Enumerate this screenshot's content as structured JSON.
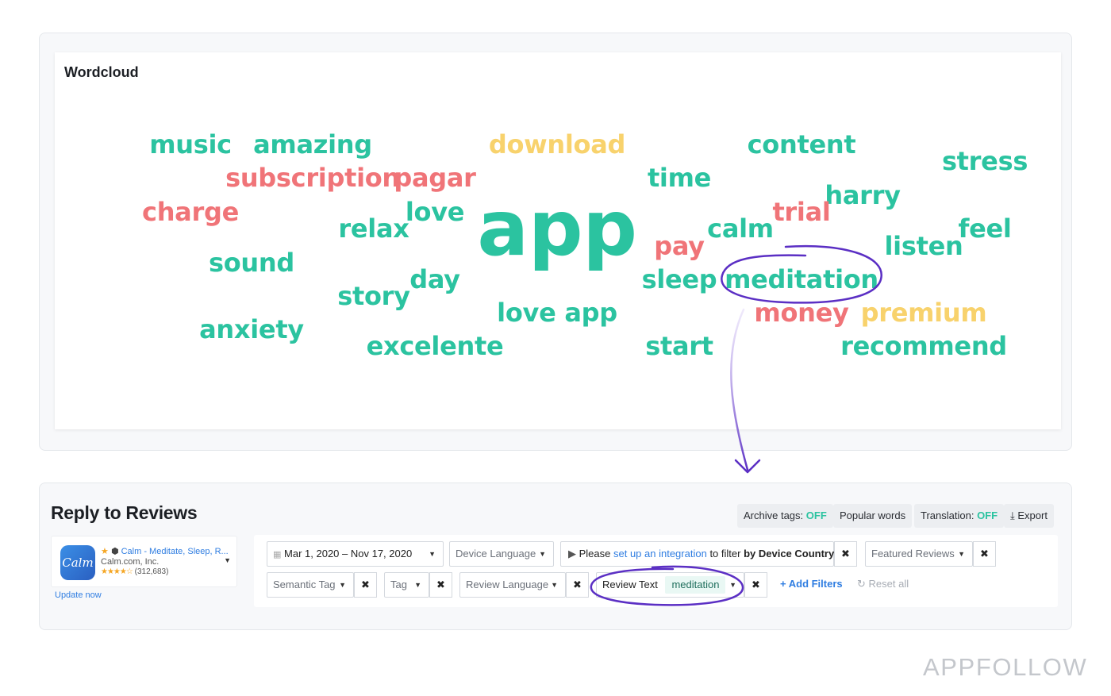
{
  "wordcloud": {
    "title": "Wordcloud",
    "words": [
      {
        "text": "music",
        "color": "green"
      },
      {
        "text": "amazing",
        "color": "green"
      },
      {
        "text": "download",
        "color": "yellow"
      },
      {
        "text": "content",
        "color": "green"
      },
      {
        "text": "stress",
        "color": "green"
      },
      {
        "text": "subscription",
        "color": "red"
      },
      {
        "text": "pagar",
        "color": "red"
      },
      {
        "text": "time",
        "color": "green"
      },
      {
        "text": "harry",
        "color": "green"
      },
      {
        "text": "charge",
        "color": "red"
      },
      {
        "text": "love",
        "color": "green"
      },
      {
        "text": "trial",
        "color": "red"
      },
      {
        "text": "app",
        "color": "green"
      },
      {
        "text": "relax",
        "color": "green"
      },
      {
        "text": "calm",
        "color": "green"
      },
      {
        "text": "feel",
        "color": "green"
      },
      {
        "text": "pay",
        "color": "red"
      },
      {
        "text": "listen",
        "color": "green"
      },
      {
        "text": "sound",
        "color": "green"
      },
      {
        "text": "day",
        "color": "green"
      },
      {
        "text": "sleep",
        "color": "green"
      },
      {
        "text": "meditation",
        "color": "green"
      },
      {
        "text": "story",
        "color": "green"
      },
      {
        "text": "love app",
        "color": "green"
      },
      {
        "text": "money",
        "color": "red"
      },
      {
        "text": "premium",
        "color": "yellow"
      },
      {
        "text": "anxiety",
        "color": "green"
      },
      {
        "text": "excelente",
        "color": "green"
      },
      {
        "text": "start",
        "color": "green"
      },
      {
        "text": "recommend",
        "color": "green"
      }
    ],
    "colors": {
      "green": "#2bc3a0",
      "red": "#f07478",
      "yellow": "#f8d26c"
    },
    "annotation": {
      "circled_word": "meditation",
      "annotation_color": "#5b2fc4"
    }
  },
  "reviews": {
    "title": "Reply to Reviews",
    "toolbar": {
      "archive_tags_label": "Archive tags:",
      "archive_tags_value": "OFF",
      "popular_words": "Popular words",
      "translation_label": "Translation:",
      "translation_value": "OFF",
      "export": "Export"
    },
    "app": {
      "name": "Calm - Meditate, Sleep, R...",
      "developer": "Calm.com, Inc.",
      "rating_count": "(312,683)",
      "rating_stars": "★★★★☆",
      "icon_text": "Calm",
      "update_now": "Update now"
    },
    "filters": {
      "date_range": "Mar 1, 2020 – Nov 17, 2020",
      "device_language": "Device Language",
      "integration_prefix": "Please",
      "integration_link": "set up an integration",
      "integration_middle": "to filter",
      "integration_bold": "by Device Country",
      "featured_reviews": "Featured Reviews",
      "semantic_tag": "Semantic Tag",
      "tag": "Tag",
      "review_language": "Review Language",
      "review_text_label": "Review Text",
      "review_text_value": "meditation",
      "add_filters": "Add Filters",
      "reset_all": "Reset all"
    }
  },
  "brand": {
    "logo": "APPFOLLOW"
  }
}
